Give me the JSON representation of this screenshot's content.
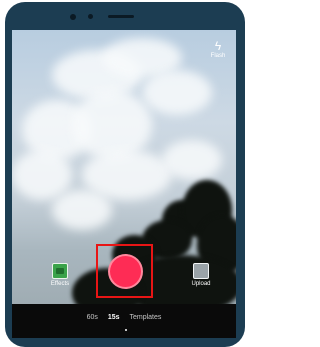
{
  "camera": {
    "flash_label": "Flash",
    "flash_icon": "flash-icon",
    "effects_label": "Effects",
    "upload_label": "Upload"
  },
  "modes": {
    "items": [
      "60s",
      "15s",
      "Templates"
    ],
    "selected": "15s"
  },
  "colors": {
    "record_button": "#fe2c55",
    "highlight_box": "#e81515",
    "bezel": "#1c3d52"
  }
}
